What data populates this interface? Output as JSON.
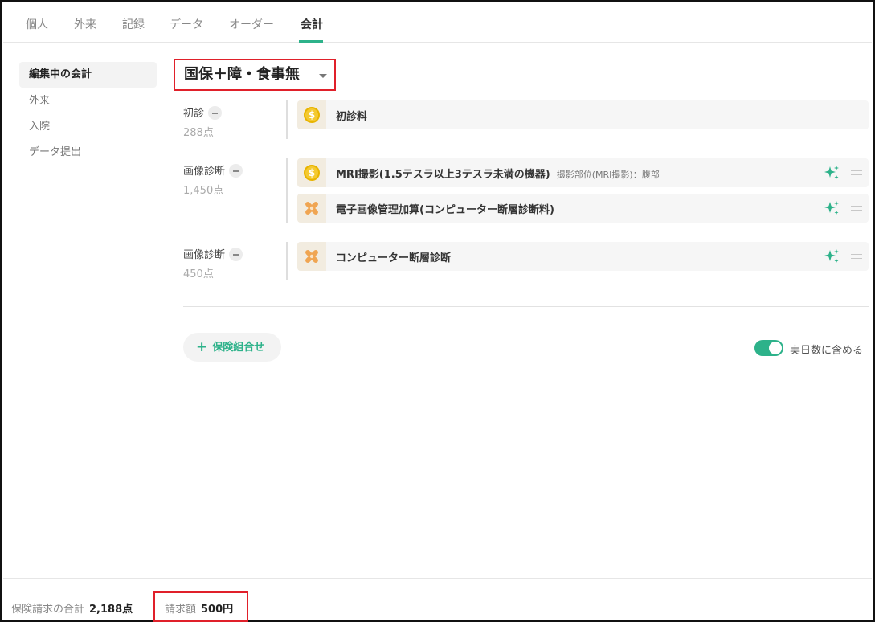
{
  "tabs": [
    {
      "label": "個人"
    },
    {
      "label": "外来"
    },
    {
      "label": "記録"
    },
    {
      "label": "データ"
    },
    {
      "label": "オーダー"
    },
    {
      "label": "会計",
      "active": true
    }
  ],
  "sidebar": {
    "items": [
      {
        "label": "編集中の会計",
        "active": true
      },
      {
        "label": "外来"
      },
      {
        "label": "入院"
      },
      {
        "label": "データ提出"
      }
    ]
  },
  "insurance": {
    "title": "国保＋障・食事無"
  },
  "groups": [
    {
      "label": "初診",
      "points": "288点",
      "items": [
        {
          "icon": "coin-icon",
          "name": "初診料",
          "detail": "",
          "ai": false
        }
      ]
    },
    {
      "label": "画像診断",
      "points": "1,450点",
      "items": [
        {
          "icon": "coin-icon",
          "name": "MRI撮影(1.5テスラ以上3テスラ未満の機器)",
          "detail": "撮影部位(MRI撮影)：腹部",
          "ai": true
        },
        {
          "icon": "bandage-icon",
          "name": "電子画像管理加算(コンピューター断層診断料)",
          "detail": "",
          "ai": true
        }
      ]
    },
    {
      "label": "画像診断",
      "points": "450点",
      "items": [
        {
          "icon": "bandage-icon",
          "name": "コンピューター断層診断",
          "detail": "",
          "ai": true
        }
      ]
    }
  ],
  "actions": {
    "add_insurance_label": "保険組合せ",
    "toggle_label": "実日数に含める",
    "toggle_on": true
  },
  "footer": {
    "insurance_total_label": "保険請求の合計",
    "insurance_total_value": "2,188点",
    "claim_label": "請求額",
    "claim_value": "500円"
  },
  "colors": {
    "accent": "#2db28a",
    "highlight_border": "#e0202a",
    "coin": "#f4c930",
    "bandage": "#f0a552"
  }
}
